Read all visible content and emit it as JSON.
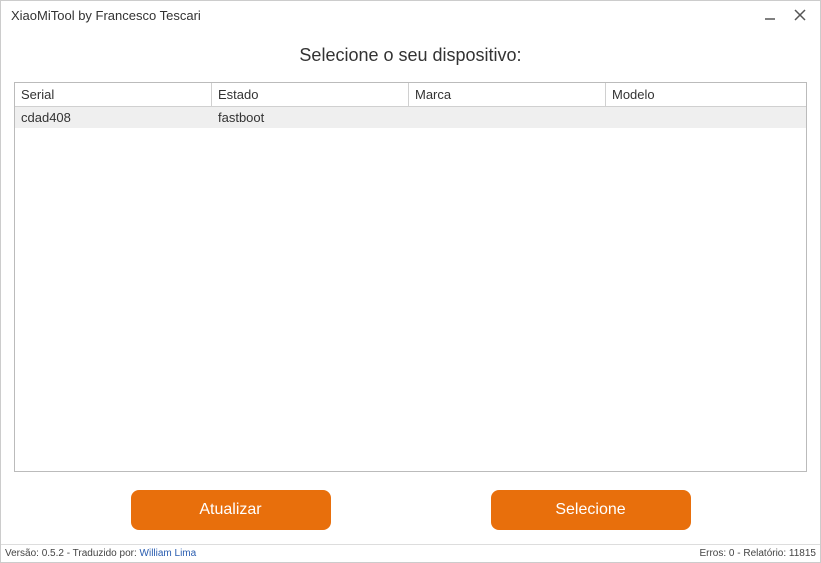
{
  "window": {
    "title": "XiaoMiTool by Francesco Tescari"
  },
  "heading": "Selecione o seu dispositivo:",
  "table": {
    "columns": {
      "serial": "Serial",
      "estado": "Estado",
      "marca": "Marca",
      "modelo": "Modelo"
    },
    "rows": [
      {
        "serial": "cdad408",
        "estado": "fastboot",
        "marca": "",
        "modelo": ""
      }
    ]
  },
  "buttons": {
    "refresh": "Atualizar",
    "select": "Selecione"
  },
  "statusbar": {
    "version_prefix": "Versão: 0.5.2 - Traduzido por: ",
    "translator": "William Lima",
    "errors": "Erros: 0 - Relatório: 11815"
  }
}
